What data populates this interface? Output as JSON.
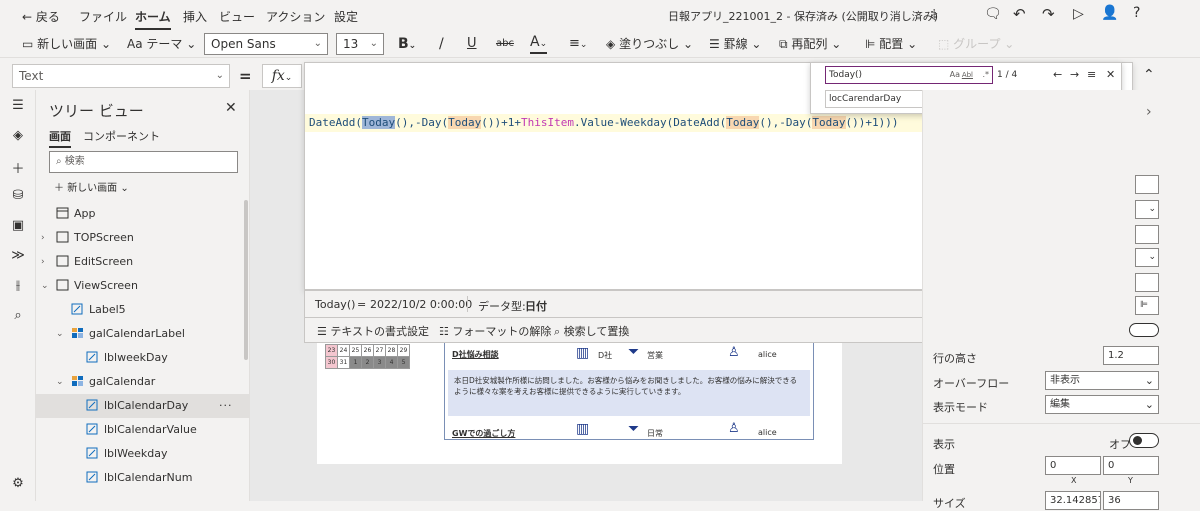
{
  "menubar": {
    "back": "← 戻る",
    "items": [
      "ファイル",
      "ホーム",
      "挿入",
      "ビュー",
      "アクション",
      "設定"
    ],
    "doc_title": "日報アプリ_221001_2 - 保存済み (公開取り消し済み)"
  },
  "toolbar": {
    "new_screen": "新しい画面",
    "theme": "テーマ",
    "font": "Open Sans",
    "font_size": "13",
    "bold": "B",
    "italic": "/",
    "underline": "U",
    "strike": "abc",
    "font_color": "A",
    "fill": "塗りつぶし",
    "border": "罫線",
    "reorder": "再配列",
    "align": "配置",
    "group": "グループ"
  },
  "formula": {
    "property": "Text",
    "equals": "=",
    "fx": "fx",
    "parts": [
      {
        "t": "DateAdd(",
        "k": "p"
      },
      {
        "t": "Today",
        "k": "sel"
      },
      {
        "t": "(),-Day(",
        "k": "p"
      },
      {
        "t": "Today",
        "k": "hl"
      },
      {
        "t": "())+1+",
        "k": "p"
      },
      {
        "t": "ThisItem",
        "k": "pink"
      },
      {
        "t": ".Value-Weekday(DateAdd(",
        "k": "p"
      },
      {
        "t": "Today",
        "k": "hl"
      },
      {
        "t": "(),-Day(",
        "k": "p"
      },
      {
        "t": "Today",
        "k": "hl"
      },
      {
        "t": "())+1)))",
        "k": "p"
      }
    ]
  },
  "find": {
    "query": "Today()",
    "opt_case": "Aa",
    "opt_word": "Abl",
    "count": "1 / 4",
    "replace": "locCarendarDay"
  },
  "status": {
    "expr": "Today()",
    "eq": "=",
    "value": "2022/10/2 0:00:00",
    "datatype_label": "データ型:",
    "datatype": "日付"
  },
  "fmtbar": {
    "format_text": "テキストの書式設定",
    "remove_format": "フォーマットの解除",
    "find_replace": "検索して置換"
  },
  "tree": {
    "title": "ツリー ビュー",
    "tab_screens": "画面",
    "tab_components": "コンポーネント",
    "search_placeholder": "検索",
    "new_screen": "新しい画面",
    "items": [
      {
        "label": "App",
        "indent": 0,
        "kind": "app",
        "caret": ""
      },
      {
        "label": "TOPScreen",
        "indent": 0,
        "kind": "screen",
        "caret": ">"
      },
      {
        "label": "EditScreen",
        "indent": 0,
        "kind": "screen",
        "caret": ">"
      },
      {
        "label": "ViewScreen",
        "indent": 0,
        "kind": "screen",
        "caret": "v"
      },
      {
        "label": "Label5",
        "indent": 1,
        "kind": "label",
        "caret": ""
      },
      {
        "label": "galCalendarLabel",
        "indent": 1,
        "kind": "gallery",
        "caret": "v"
      },
      {
        "label": "lblweekDay",
        "indent": 2,
        "kind": "label",
        "caret": ""
      },
      {
        "label": "galCalendar",
        "indent": 1,
        "kind": "gallery",
        "caret": "v"
      },
      {
        "label": "lblCalendarDay",
        "indent": 2,
        "kind": "label",
        "caret": "",
        "selected": true
      },
      {
        "label": "lblCalendarValue",
        "indent": 2,
        "kind": "label",
        "caret": ""
      },
      {
        "label": "lblWeekday",
        "indent": 2,
        "kind": "label",
        "caret": ""
      },
      {
        "label": "lblCalendarNum",
        "indent": 2,
        "kind": "label",
        "caret": ""
      }
    ],
    "more": "···"
  },
  "canvas": {
    "calendar_rows": [
      [
        "23",
        "24",
        "25",
        "26",
        "27",
        "28",
        "29"
      ],
      [
        "30",
        "31",
        "1",
        "2",
        "3",
        "4",
        "5"
      ]
    ],
    "report1": {
      "title": "D社悩み相談",
      "company": "D社",
      "category": "営業",
      "user": "alice",
      "body": "本日D社安城製作所様に訪問しました。お客様から悩みをお聞きしました。お客様の悩みに解決できるように様々な案を考えお客様に提供できるように実行していきます。"
    },
    "report2": {
      "title": "GWでの過ごし方",
      "category": "日常",
      "user": "alice"
    }
  },
  "props": {
    "line_height_label": "行の高さ",
    "line_height": "1.2",
    "overflow_label": "オーバーフロー",
    "overflow": "非表示",
    "display_mode_label": "表示モード",
    "display_mode": "編集",
    "visible_label": "表示",
    "visible_state": "オフ",
    "position_label": "位置",
    "x": "0",
    "y": "0",
    "x_label": "X",
    "y_label": "Y",
    "size_label": "サイズ",
    "width": "32.1428571",
    "height": "36"
  },
  "colors": {
    "accent": "#742774",
    "highlight": "#f8d7b0",
    "selection": "#9fb6d8",
    "calendar_pink": "#f4c6cf",
    "calendar_gray": "#8a8a8a"
  }
}
